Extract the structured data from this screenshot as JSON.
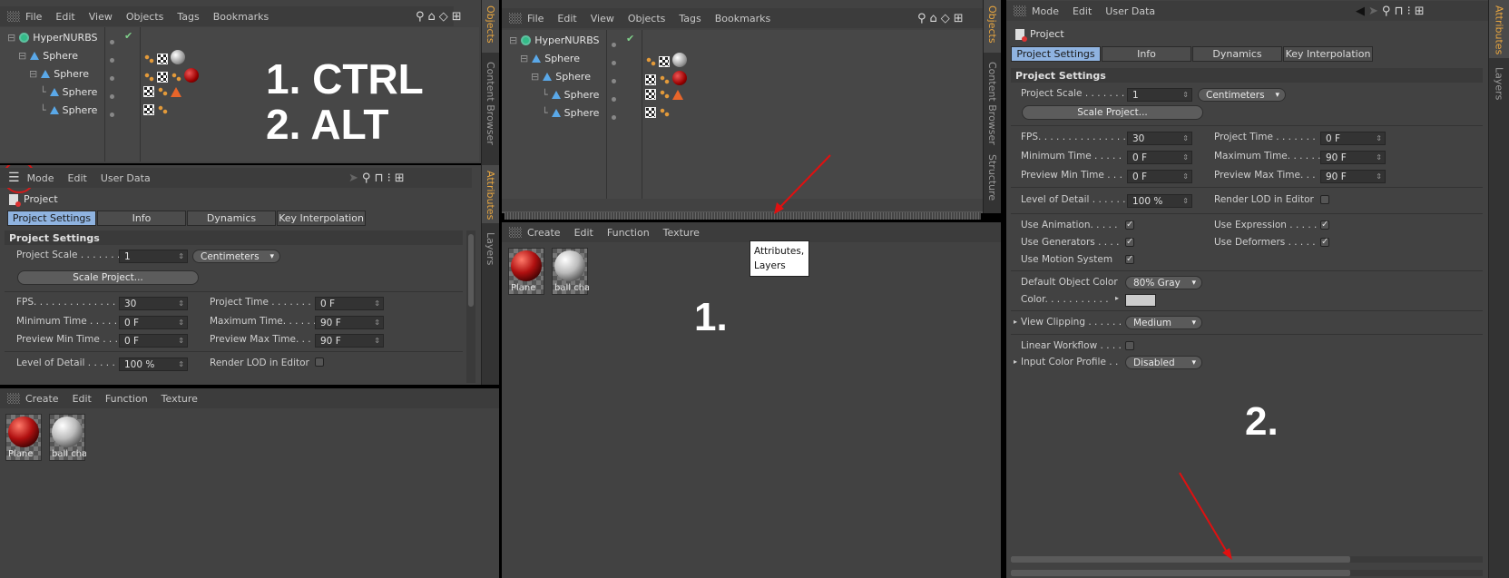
{
  "menus": {
    "object_manager": [
      "File",
      "Edit",
      "View",
      "Objects",
      "Tags",
      "Bookmarks"
    ],
    "attribute_manager": [
      "Mode",
      "Edit",
      "User Data"
    ],
    "material_manager": [
      "Create",
      "Edit",
      "Function",
      "Texture"
    ]
  },
  "objects": [
    {
      "name": "HyperNURBS",
      "indent": 0,
      "type": "nurbs"
    },
    {
      "name": "Sphere",
      "indent": 1,
      "type": "sphere"
    },
    {
      "name": "Sphere",
      "indent": 2,
      "type": "sphere"
    },
    {
      "name": "Sphere",
      "indent": 3,
      "type": "sphere"
    },
    {
      "name": "Sphere",
      "indent": 3,
      "type": "sphere"
    }
  ],
  "side_tabs": {
    "left_top": [
      "Objects",
      "Content Browser"
    ],
    "left_bottom": [
      "Attributes",
      "Layers"
    ],
    "middle": [
      "Objects",
      "Content Browser",
      "Structure"
    ],
    "right": [
      "Attributes",
      "Layers"
    ]
  },
  "annotations": {
    "step1": "1. CTRL",
    "step2": "2. ALT",
    "mid_label": "1.",
    "right_label": "2.",
    "tooltip_line1": "Attributes,",
    "tooltip_line2": "Layers"
  },
  "attributes": {
    "title": "Project",
    "tabs": [
      "Project Settings",
      "Info",
      "Dynamics",
      "Key Interpolation"
    ],
    "section": "Project Settings",
    "project_scale_label": "Project Scale . . . . . . .",
    "project_scale_value": "1",
    "project_scale_unit": "Centimeters",
    "scale_button": "Scale Project...",
    "fps_label": "FPS. . . . . . . . . . . . . . . .",
    "fps_value": "30",
    "project_time_label": "Project Time . . . . . . .",
    "project_time_value": "0 F",
    "min_time_label": "Minimum Time . . . . .",
    "min_time_value": "0 F",
    "max_time_label": "Maximum Time. . . . . .",
    "max_time_value": "90 F",
    "prev_min_label": "Preview Min Time . . .",
    "prev_min_value": "0 F",
    "prev_max_label": "Preview Max Time. . .",
    "prev_max_value": "90 F",
    "lod_label": "Level of Detail . . . . . .",
    "lod_value": "100 %",
    "render_lod_label": "Render LOD in Editor",
    "use_animation_label": "Use Animation. . . . .",
    "use_expression_label": "Use Expression . . . . .",
    "use_generators_label": "Use Generators . . . .",
    "use_deformers_label": "Use Deformers . . . . .",
    "use_motion_label": "Use Motion System",
    "default_color_label": "Default Object Color",
    "default_color_value": "80% Gray",
    "color_label": "Color. . . . . . . . . . .",
    "view_clipping_label": "View Clipping . . . . . .",
    "view_clipping_value": "Medium",
    "linear_workflow_label": "Linear Workflow . . . .",
    "input_color_label": "Input Color Profile . .",
    "input_color_value": "Disabled"
  },
  "materials": [
    {
      "name": "Plane",
      "kind": "red"
    },
    {
      "name": "ball cha",
      "kind": "white"
    }
  ],
  "colors": {
    "panel_bg": "#424242",
    "tab_active": "#8fb3e0",
    "side_tab_active": "#e8a640",
    "arrow": "#e01010",
    "circle": "#d41a1a"
  }
}
